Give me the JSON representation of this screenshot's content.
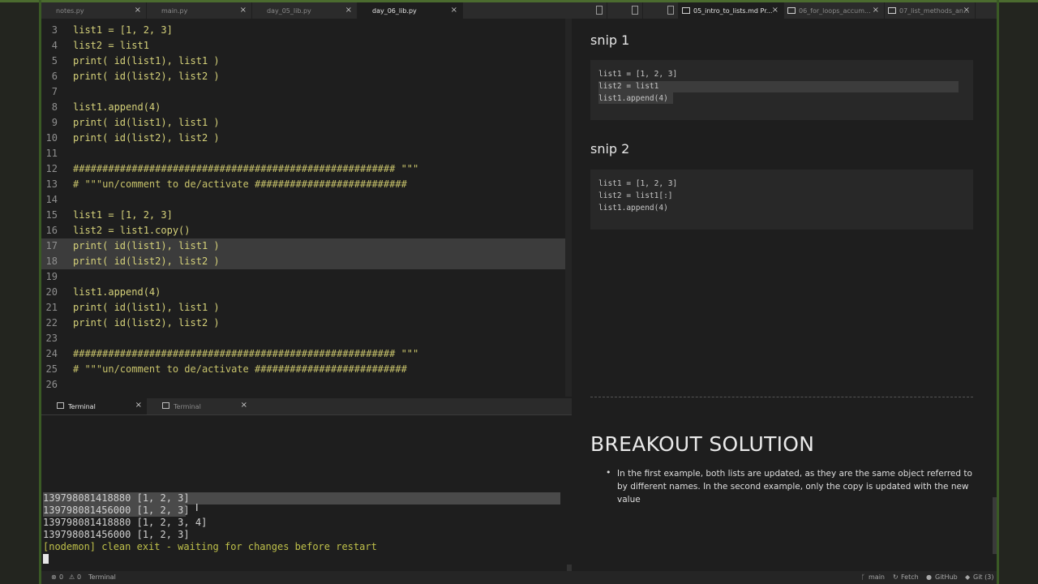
{
  "editor_tabs": [
    {
      "label": "notes.py",
      "active": false
    },
    {
      "label": "main.py",
      "active": false
    },
    {
      "label": "day_05_lib.py",
      "active": false
    },
    {
      "label": "day_06_lib.py",
      "active": true
    }
  ],
  "preview_tabs": [
    {
      "label": "",
      "icon": "file-icon"
    },
    {
      "label": "",
      "icon": "file-icon"
    },
    {
      "label": "",
      "icon": "file-icon"
    },
    {
      "label": "05_intro_to_lists.md Pr...",
      "active": true
    },
    {
      "label": "06_for_loops_accum..."
    },
    {
      "label": "07_list_methods_an..."
    }
  ],
  "code_lines": [
    {
      "n": "3",
      "text": "list1 = [1, 2, 3]"
    },
    {
      "n": "4",
      "text": "list2 = list1"
    },
    {
      "n": "5",
      "text": "print( id(list1), list1 )"
    },
    {
      "n": "6",
      "text": "print( id(list2), list2 )"
    },
    {
      "n": "7",
      "text": ""
    },
    {
      "n": "8",
      "text": "list1.append(4)"
    },
    {
      "n": "9",
      "text": "print( id(list1), list1 )"
    },
    {
      "n": "10",
      "text": "print( id(list2), list2 )"
    },
    {
      "n": "11",
      "text": ""
    },
    {
      "n": "12",
      "text": "####################################################### \"\"\""
    },
    {
      "n": "13",
      "text": "# \"\"\"un/comment to de/activate ##########################"
    },
    {
      "n": "14",
      "text": ""
    },
    {
      "n": "15",
      "text": "list1 = [1, 2, 3]"
    },
    {
      "n": "16",
      "text": "list2 = list1.copy()"
    },
    {
      "n": "17",
      "text": "print( id(list1), list1 )"
    },
    {
      "n": "18",
      "text": "print( id(list2), list2 )"
    },
    {
      "n": "19",
      "text": ""
    },
    {
      "n": "20",
      "text": "list1.append(4)"
    },
    {
      "n": "21",
      "text": "print( id(list1), list1 )"
    },
    {
      "n": "22",
      "text": "print( id(list2), list2 )"
    },
    {
      "n": "23",
      "text": ""
    },
    {
      "n": "24",
      "text": "####################################################### \"\"\""
    },
    {
      "n": "25",
      "text": "# \"\"\"un/comment to de/activate ##########################"
    },
    {
      "n": "26",
      "text": ""
    }
  ],
  "terminal_tabs": [
    {
      "label": "Terminal",
      "active": true
    },
    {
      "label": "Terminal",
      "active": false
    }
  ],
  "terminal_lines": [
    "139798081418880 [1, 2, 3]",
    "139798081456000 [1, 2, 3]",
    "139798081418880 [1, 2, 3, 4]",
    "139798081456000 [1, 2, 3]",
    "[nodemon] clean exit - waiting for changes before restart"
  ],
  "preview": {
    "snip1_title": "snip 1",
    "snip1_lines": [
      "list1 = [1, 2, 3]",
      "list2 = list1",
      "list1.append(4)"
    ],
    "snip2_title": "snip 2",
    "snip2_lines": [
      "list1 = [1, 2, 3]",
      "list2 = list1[:]",
      "list1.append(4)"
    ],
    "breakout_title": "BREAKOUT SOLUTION",
    "breakout_text": "In the first example, both lists are updated, as they are the same object referred to by different names. In the second example, only the copy is updated with the new value"
  },
  "statusbar": {
    "errors": "0",
    "warnings": "0",
    "terminal": "Terminal",
    "branch": "main",
    "fetch": "Fetch",
    "github": "GitHub",
    "git": "Git (3)"
  },
  "colors": {
    "accent_green": "#4b6b2f",
    "code_yellow": "#d6d27a",
    "number_purple": "#c9a0dc",
    "function_blue": "#6fb8d6",
    "nodemon_yellow": "#bfc04a"
  }
}
